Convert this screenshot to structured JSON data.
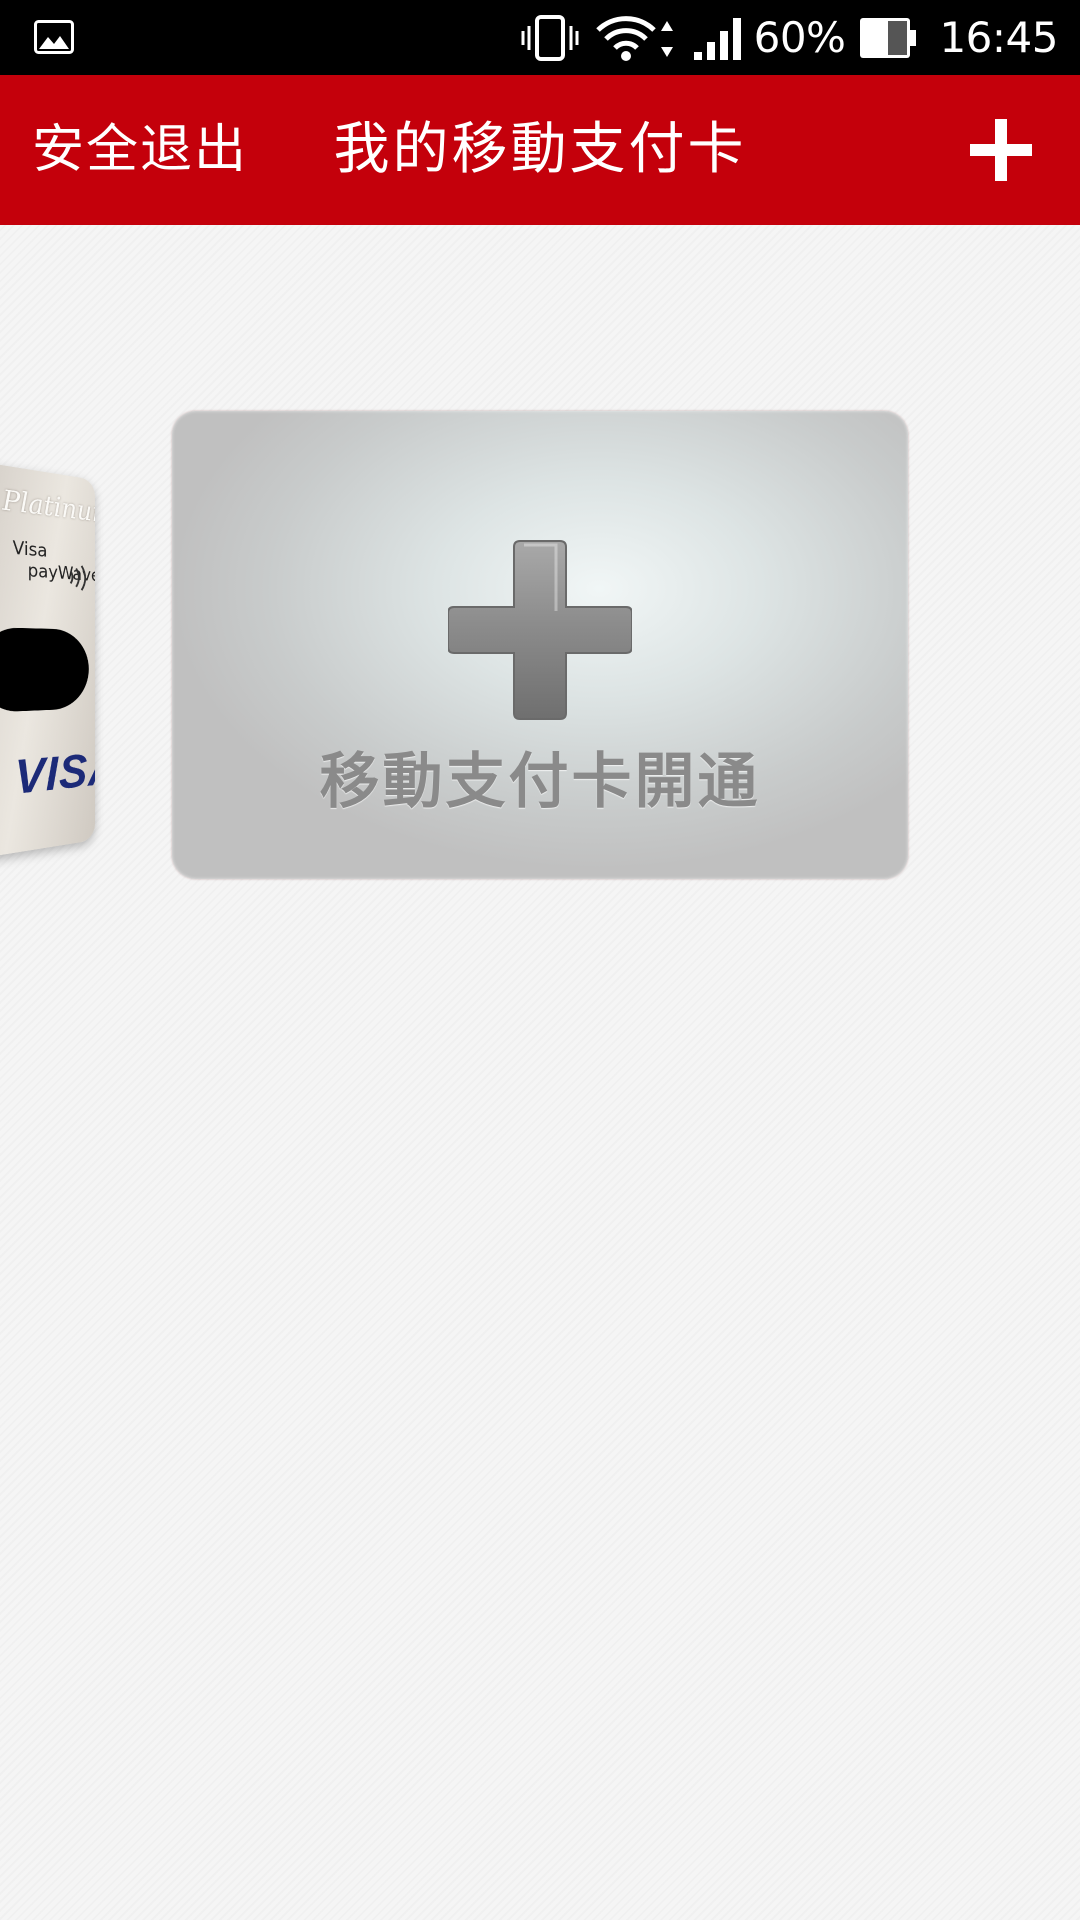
{
  "status_bar": {
    "gallery_icon": "gallery-icon",
    "vibrate_icon": "vibrate-icon",
    "wifi_icon": "wifi-icon",
    "signal_icon": "signal-icon",
    "battery_level": 0.6,
    "battery_text": "60%",
    "time": "16:45"
  },
  "app_bar": {
    "logout_label": "安全退出",
    "title": "我的移動支付卡",
    "add_icon": "plus-icon",
    "background_color": "#c4000b"
  },
  "cards": {
    "previous_card": {
      "platinum_text": "Platinum",
      "visa_small_text": "Visa",
      "paywave_text": "payWave",
      "brand": "VISA"
    },
    "add_card": {
      "icon": "plus-icon",
      "label": "移動支付卡開通"
    }
  }
}
